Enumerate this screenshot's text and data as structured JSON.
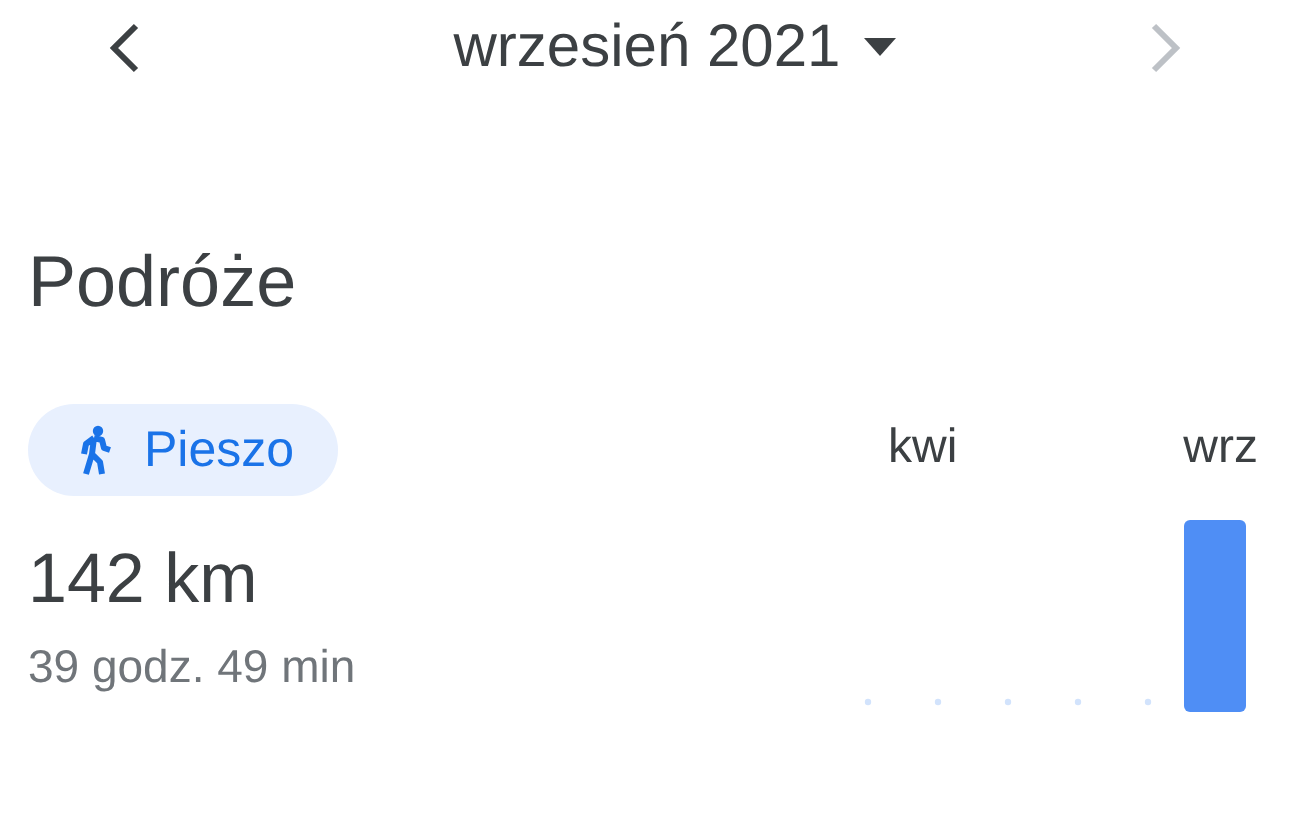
{
  "header": {
    "title": "wrzesień 2021",
    "prev": {
      "disabled": false
    },
    "next": {
      "disabled": true
    }
  },
  "section": {
    "title": "Podróże"
  },
  "mode_chip": {
    "label": "Pieszo"
  },
  "distance": "142 km",
  "duration": "39 godz. 49 min",
  "chart": {
    "labels": [
      "kwi",
      "wrz"
    ]
  }
}
